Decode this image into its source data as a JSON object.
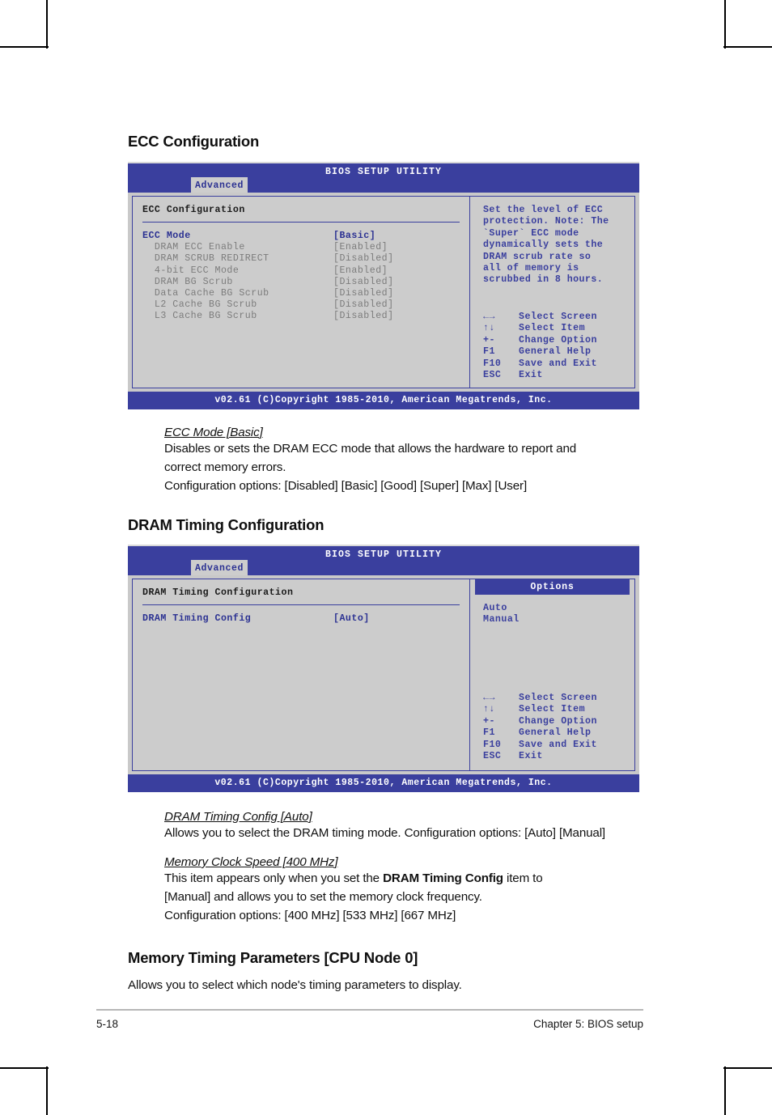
{
  "page": {
    "footer_left": "5-18",
    "footer_right": "Chapter 5: BIOS setup"
  },
  "sections": {
    "ecc": {
      "heading": "ECC Configuration",
      "item_title": "ECC Mode [Basic]",
      "desc_line1": "Disables or sets the DRAM ECC mode that allows the hardware to report and",
      "desc_line2": "correct memory errors.",
      "desc_line3": "Configuration options: [Disabled] [Basic] [Good] [Super] [Max] [User]"
    },
    "dram": {
      "heading": "DRAM Timing Configuration",
      "item1_title": "DRAM Timing Config [Auto]",
      "item1_desc": "Allows you to select the DRAM timing mode. Configuration options: [Auto] [Manual]",
      "item2_title": "Memory Clock Speed [400 MHz]",
      "item2_desc_a": "This item appears only when you set the ",
      "item2_desc_bold": "DRAM Timing Config",
      "item2_desc_b": " item to",
      "item2_desc_line2": "[Manual] and allows you to set the memory clock frequency.",
      "item2_desc_line3": "Configuration options: [400 MHz] [533 MHz] [667 MHz]"
    },
    "memory_timing": {
      "heading": "Memory Timing Parameters [CPU Node 0]",
      "desc": "Allows you to select which node's timing parameters to display."
    }
  },
  "bios_screen_1": {
    "title": "BIOS SETUP UTILITY",
    "tab": "Advanced",
    "pane_title": "ECC Configuration",
    "rows": [
      {
        "label": "ECC Mode",
        "value": "[Basic]",
        "state": "selected"
      },
      {
        "label": "  DRAM ECC Enable",
        "value": "[Enabled]",
        "state": "dim"
      },
      {
        "label": "  DRAM SCRUB REDIRECT",
        "value": "[Disabled]",
        "state": "dim"
      },
      {
        "label": "  4-bit ECC Mode",
        "value": "[Enabled]",
        "state": "dim"
      },
      {
        "label": "  DRAM BG Scrub",
        "value": "[Disabled]",
        "state": "dim"
      },
      {
        "label": "  Data Cache BG Scrub",
        "value": "[Disabled]",
        "state": "dim"
      },
      {
        "label": "  L2 Cache BG Scrub",
        "value": "[Disabled]",
        "state": "dim"
      },
      {
        "label": "  L3 Cache BG Scrub",
        "value": "[Disabled]",
        "state": "dim"
      }
    ],
    "help_text": "Set the level of ECC\nprotection. Note: The\n`Super` ECC mode\ndynamically sets the\nDRAM scrub rate so\nall of memory is\nscrubbed in 8 hours.",
    "legend": [
      {
        "key": "←→",
        "action": "Select Screen"
      },
      {
        "key": "↑↓",
        "action": "Select Item"
      },
      {
        "key": "+-",
        "action": "Change Option"
      },
      {
        "key": "F1",
        "action": "General Help"
      },
      {
        "key": "F10",
        "action": "Save and Exit"
      },
      {
        "key": "ESC",
        "action": "Exit"
      }
    ],
    "footer": "v02.61 (C)Copyright 1985-2010, American Megatrends, Inc."
  },
  "bios_screen_2": {
    "title": "BIOS SETUP UTILITY",
    "tab": "Advanced",
    "pane_title": "DRAM Timing Configuration",
    "rows": [
      {
        "label": "DRAM Timing Config",
        "value": "[Auto]",
        "state": "selected"
      }
    ],
    "options_header": "Options",
    "options": [
      "Auto",
      "Manual"
    ],
    "legend": [
      {
        "key": "←→",
        "action": "Select Screen"
      },
      {
        "key": "↑↓",
        "action": "Select Item"
      },
      {
        "key": "+-",
        "action": "Change Option"
      },
      {
        "key": "F1",
        "action": "General Help"
      },
      {
        "key": "F10",
        "action": "Save and Exit"
      },
      {
        "key": "ESC",
        "action": "Exit"
      }
    ],
    "footer": "v02.61 (C)Copyright 1985-2010, American Megatrends, Inc."
  },
  "colors": {
    "bios_blue": "#3a3f9e",
    "bios_gray": "#c9c9c9",
    "text_blue": "#2b3192",
    "dim_gray": "#7c7c7c"
  }
}
